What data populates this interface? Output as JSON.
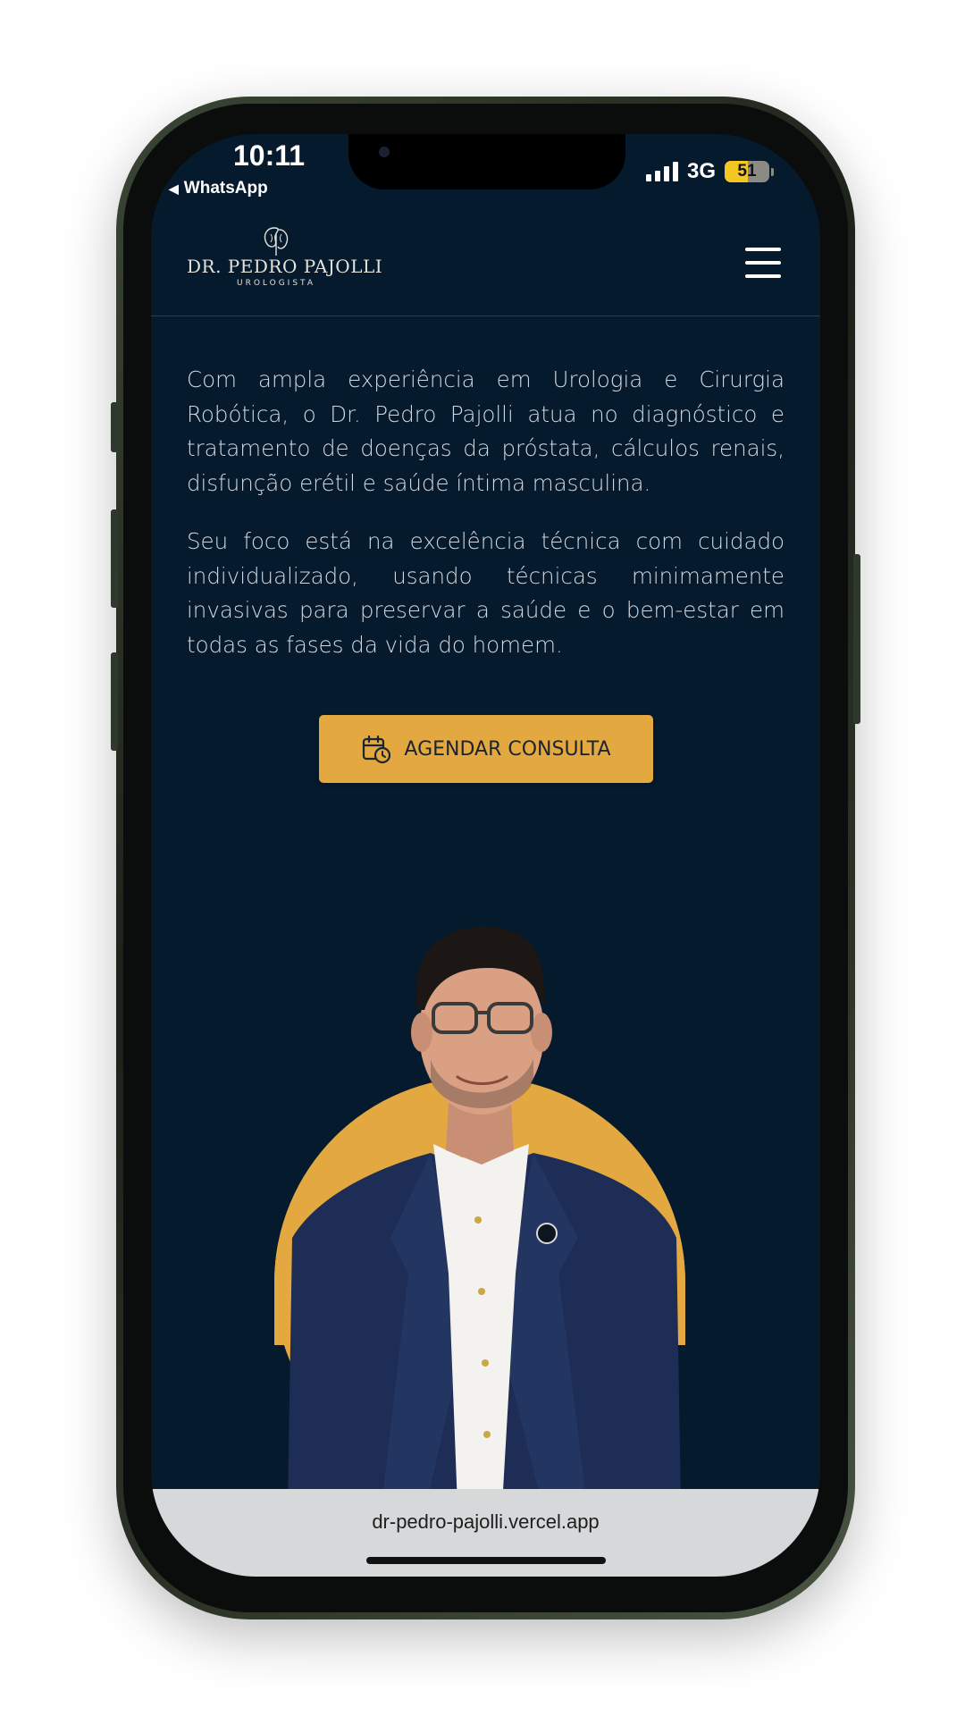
{
  "status_bar": {
    "time": "10:11",
    "back_app": "WhatsApp",
    "network": "3G",
    "battery": "51",
    "battery_level_percent": 51
  },
  "header": {
    "logo_name": "DR. PEDRO PAJOLLI",
    "logo_subtitle": "UROLOGISTA",
    "logo_icon": "kidney-icon",
    "menu_icon": "hamburger-menu-icon"
  },
  "content": {
    "paragraph_1": "Com ampla experiência em Urologia e Cirurgia Robótica, o Dr. Pedro Pajolli atua no diagnóstico e tratamento de doenças da próstata, cálculos renais, disfunção erétil e saúde íntima masculina.",
    "paragraph_2": "Seu foco está na excelência técnica com cuidado individualizado, usando técnicas minimamente invasivas para preservar a saúde e o bem-estar em todas as fases da vida do homem."
  },
  "cta": {
    "label": "AGENDAR CONSULTA",
    "icon": "calendar-clock-icon"
  },
  "browser": {
    "url": "dr-pedro-pajolli.vercel.app"
  },
  "colors": {
    "background": "#061a2d",
    "accent": "#e3a83f",
    "text": "#d3d8de"
  }
}
